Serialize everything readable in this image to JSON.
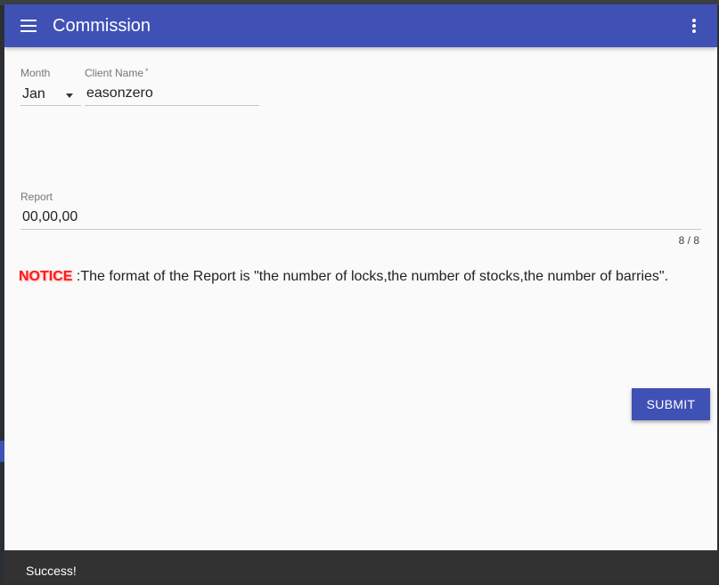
{
  "appbar": {
    "title": "Commission",
    "menu_icon": "menu-icon",
    "more_icon": "more-vert-icon",
    "color": "#3f51b5"
  },
  "form": {
    "month": {
      "label": "Month",
      "value": "Jan"
    },
    "client_name": {
      "label": "Client Name",
      "required_mark": "*",
      "value": "easonzero"
    },
    "report": {
      "label": "Report",
      "value": "00,00,00",
      "counter": "8 / 8"
    }
  },
  "notice": {
    "label": "NOTICE",
    "text": ":The format of the Report is \"the number of locks,the number of stocks,the number of barries\".",
    "label_color": "#ff1a1a"
  },
  "submit": {
    "label": "SUBMIT"
  },
  "snackbar": {
    "message": "Success!"
  }
}
